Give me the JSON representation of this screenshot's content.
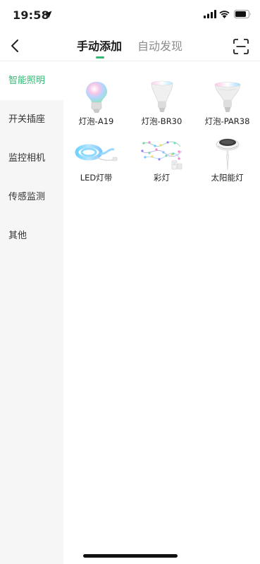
{
  "status_bar": {
    "time": "19:58"
  },
  "nav": {
    "tabs": [
      {
        "label": "手动添加",
        "active": true
      },
      {
        "label": "自动发现",
        "active": false
      }
    ]
  },
  "sidebar": {
    "items": [
      {
        "label": "智能照明",
        "active": true
      },
      {
        "label": "开关插座",
        "active": false
      },
      {
        "label": "监控相机",
        "active": false
      },
      {
        "label": "传感监测",
        "active": false
      },
      {
        "label": "其他",
        "active": false
      }
    ]
  },
  "devices": [
    {
      "label": "灯泡-A19",
      "icon": "bulb-a19-icon"
    },
    {
      "label": "灯泡-BR30",
      "icon": "bulb-br30-icon"
    },
    {
      "label": "灯泡-PAR38",
      "icon": "bulb-par38-icon"
    },
    {
      "label": "LED灯带",
      "icon": "led-strip-icon"
    },
    {
      "label": "彩灯",
      "icon": "string-lights-icon"
    },
    {
      "label": "太阳能灯",
      "icon": "solar-light-icon"
    }
  ],
  "colors": {
    "accent": "#37b877",
    "sidebar_bg": "#f6f6f6",
    "inactive_tab": "#8c8c8c"
  }
}
